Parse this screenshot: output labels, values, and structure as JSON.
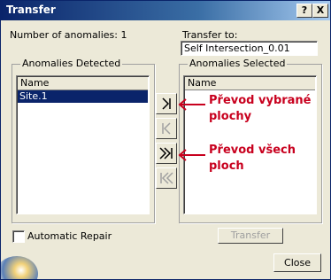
{
  "window": {
    "title": "Transfer"
  },
  "title_buttons": {
    "help": "?",
    "close": "X"
  },
  "anomaly_count": "Number of anomalies: 1",
  "transfer_to": {
    "label": "Transfer to:",
    "value": "Self Intersection_0.01"
  },
  "detected": {
    "legend": "Anomalies Detected",
    "column": "Name",
    "rows": [
      "Site.1"
    ]
  },
  "selected": {
    "legend": "Anomalies Selected",
    "column": "Name"
  },
  "annotations": {
    "line1": "Převod vybrané",
    "line2": "plochy",
    "line3": "Převod všech",
    "line4": "ploch"
  },
  "auto_repair_label": "Automatic Repair",
  "auto_repair_checked": false,
  "buttons": {
    "transfer": "Transfer",
    "close": "Close"
  },
  "colors": {
    "annotation": "#c8001e",
    "selection": "#0a246a",
    "titlebar": "#0a246a"
  }
}
